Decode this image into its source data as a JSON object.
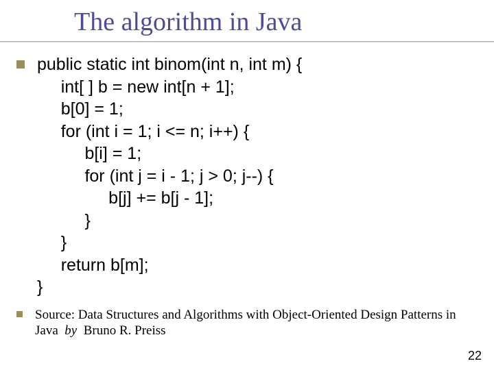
{
  "title": "The algorithm in Java",
  "code": [
    "public static int binom(int n, int m) {",
    "     int[ ] b = new int[n + 1];",
    "     b[0] = 1;",
    "     for (int i = 1; i <= n; i++) {",
    "          b[i] = 1;",
    "          for (int j = i - 1; j > 0; j--) {",
    "               b[j] += b[j - 1];",
    "          }",
    "     }",
    "     return b[m];",
    "}"
  ],
  "source": {
    "prefix": "Source: Data Structures and Algorithms with Object-Oriented Design Patterns in Java",
    "by": "by",
    "author": "Bruno R. Preiss"
  },
  "page": "22"
}
